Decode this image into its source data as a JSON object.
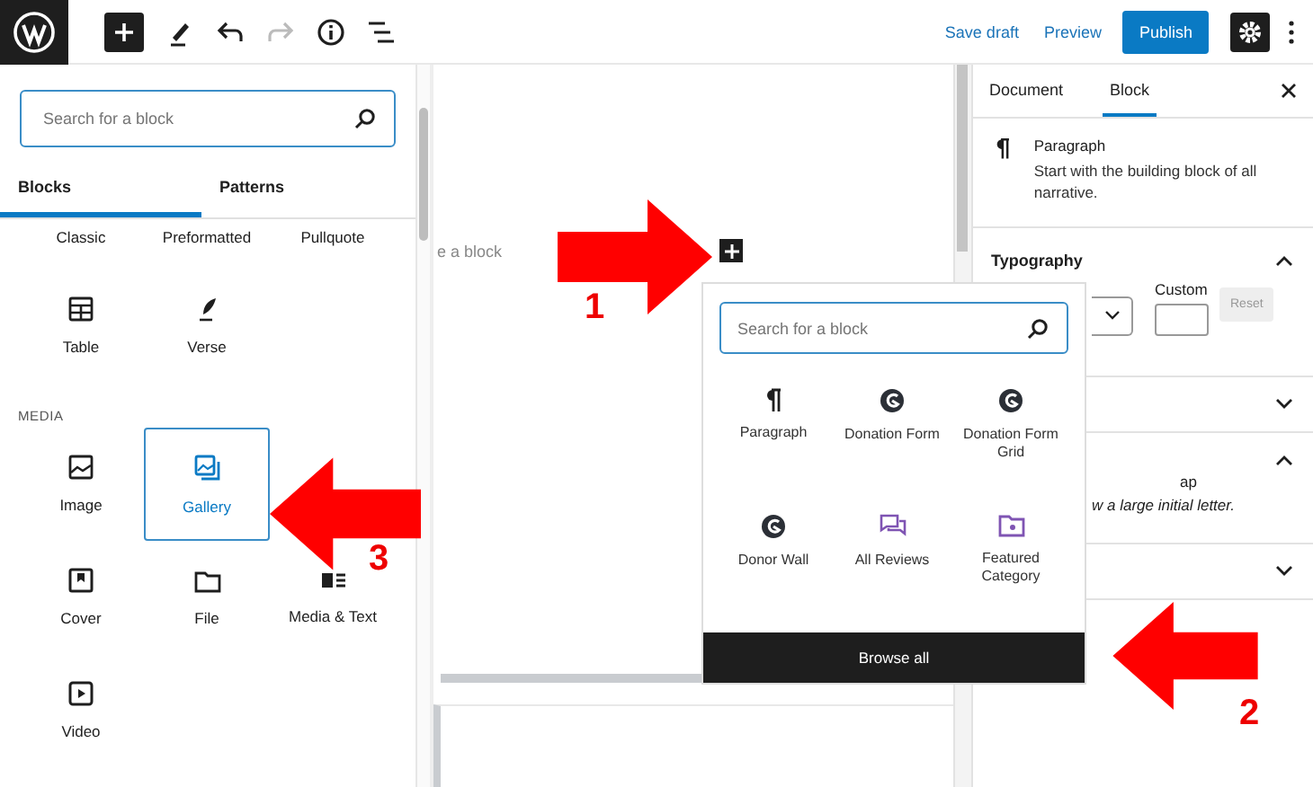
{
  "toolbar": {
    "tools": [
      {
        "kind": "add",
        "disabled": false
      },
      {
        "kind": "edit",
        "disabled": false
      },
      {
        "kind": "undo",
        "disabled": false
      },
      {
        "kind": "redo",
        "disabled": true
      },
      {
        "kind": "info",
        "disabled": false
      },
      {
        "kind": "outline",
        "disabled": false
      }
    ],
    "save_draft": "Save draft",
    "preview": "Preview",
    "publish": "Publish"
  },
  "inserter": {
    "search": {
      "placeholder": "Search for a block"
    },
    "tabs": [
      {
        "label": "Blocks",
        "selected": true
      },
      {
        "label": "Patterns",
        "selected": false
      }
    ],
    "top_blocks": [
      {
        "label": "Classic",
        "kind": "none",
        "selected": false
      },
      {
        "label": "Preformatted",
        "kind": "none",
        "selected": false
      },
      {
        "label": "Pullquote",
        "kind": "none",
        "selected": false
      },
      {
        "label": "Table",
        "kind": "table",
        "selected": false
      },
      {
        "label": "Verse",
        "kind": "verse",
        "selected": false
      }
    ],
    "media": {
      "heading": "MEDIA",
      "items": [
        {
          "label": "Image",
          "kind": "image",
          "selected": false
        },
        {
          "label": "Gallery",
          "kind": "gallery",
          "selected": true
        },
        {
          "label": "Cover",
          "kind": "cover",
          "selected": false
        },
        {
          "label": "File",
          "kind": "file",
          "selected": false
        },
        {
          "label": "Media & Text",
          "kind": "mediatext",
          "selected": false
        },
        {
          "label": "Video",
          "kind": "video",
          "selected": false
        }
      ]
    }
  },
  "canvas": {
    "placeholder": "e a block"
  },
  "quick_inserter": {
    "search": {
      "placeholder": "Search for a block"
    },
    "items": [
      {
        "label": "Paragraph",
        "kind": "paragraph"
      },
      {
        "label": "Donation Form",
        "kind": "give"
      },
      {
        "label": "Donation Form Grid",
        "kind": "give"
      },
      {
        "label": "Donor Wall",
        "kind": "give"
      },
      {
        "label": "All Reviews",
        "kind": "reviews"
      },
      {
        "label": "Featured Category",
        "kind": "folder"
      }
    ],
    "browse_all": "Browse all"
  },
  "sidebar": {
    "tabs": [
      {
        "label": "Document",
        "selected": false
      },
      {
        "label": "Block",
        "selected": true
      }
    ],
    "block": {
      "name": "Paragraph",
      "description": "Start with the building block of all narrative."
    },
    "typography": {
      "title": "Typography",
      "expanded": true,
      "custom_label": "Custom",
      "reset": "Reset"
    },
    "panels": [
      {
        "expanded": false
      },
      {
        "expanded": true,
        "lines": [
          "ap",
          "w a large initial letter."
        ]
      },
      {
        "expanded": false
      }
    ]
  },
  "annotations": [
    {
      "number": "1",
      "kind": "right"
    },
    {
      "number": "2",
      "kind": "left"
    },
    {
      "number": "3",
      "kind": "left"
    }
  ]
}
